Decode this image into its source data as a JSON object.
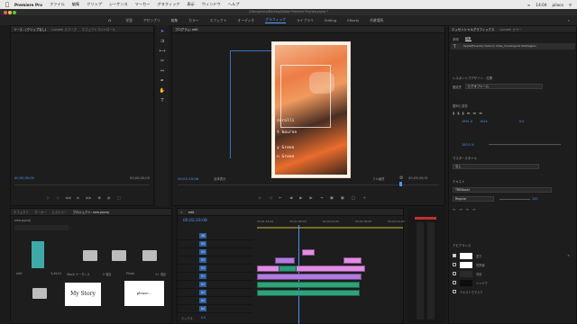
{
  "menubar": {
    "app": "Premiere Pro",
    "items": [
      "ファイル",
      "編集",
      "クリップ",
      "シーケンス",
      "マーカー",
      "グラフィック",
      "表示",
      "ウィンドウ",
      "ヘルプ"
    ],
    "time": "14:04",
    "user": "pilaco"
  },
  "titlebar": {
    "path": "/Users/pilaco/Desktop/Adobe Premiere Pro/new.prproj *"
  },
  "workspaces": {
    "items": [
      "学習",
      "アセンブリ",
      "編集",
      "カラー",
      "エフェクト",
      "オーディオ",
      "グラフィック",
      "ライブラリ",
      "Editing",
      "Effects",
      "作業場所"
    ],
    "active_index": 6
  },
  "source": {
    "tabs": [
      "ソース : (クリップなし)",
      "Lumetri スコープ",
      "エフェクトコントロール"
    ],
    "active_tab": 0,
    "timecode_left": "00;00;00;00",
    "timecode_right": "00;00;00;00"
  },
  "program": {
    "tab": "プログラム: edit",
    "timecode": "00;02;19;08",
    "fit": "全体表示",
    "quality": "フル画質",
    "duration": "00;03;45;01",
    "overlay_lines": [
      "scrolli",
      "t bourne",
      "y Green",
      "n Green"
    ]
  },
  "essential": {
    "tabs": [
      "エッセンシャルグラフィックス",
      "Lumetri カラー"
    ],
    "subtabs": [
      "参照",
      "編集"
    ],
    "active_subtab": 1,
    "layer": "Sp[lat]Fluente] Verbum Vitae_Vocalkaynet Methaglian",
    "responsive_label": "レスポンシブデザイン - 位置",
    "pin_label": "固定先",
    "pin_value": "ビデオフレーム",
    "align_label": "整列と変形",
    "position_x": "1091.0",
    "position_y": "1024",
    "rotation": "0.0",
    "scale": "100.0 %",
    "master_style_label": "マスタースタイル",
    "master_style_value": "なし",
    "text_label": "テキスト",
    "font": "TRBBoost",
    "font_style": "Regular",
    "font_size": "120",
    "appearance_label": "アピアランス",
    "appearance_items": [
      "塗り",
      "境界線",
      "背景",
      "シャドウ",
      "テキストでマスク"
    ]
  },
  "project": {
    "tabs": [
      "エフェクト",
      "マーカー",
      "ヒストリー",
      "プロジェクト: new.prproj"
    ],
    "active_tab": 3,
    "file": "new.prproj",
    "items": [
      {
        "name": "edit",
        "duration": "3;45;01",
        "kind": "sequence"
      },
      {
        "name": "Stock ナーダンス",
        "duration": "",
        "kind": "folder"
      },
      {
        "name": "2 項目",
        "duration": "",
        "kind": "folder"
      },
      {
        "name": "Photo",
        "duration": "",
        "kind": "folder"
      },
      {
        "name": "1+ 項目",
        "duration": "",
        "kind": "folder"
      },
      {
        "name": "",
        "duration": "",
        "kind": "folder"
      },
      {
        "name": "",
        "duration": "",
        "kind": "handwritten",
        "text": "My Story"
      },
      {
        "name": "",
        "duration": "",
        "kind": "handwritten",
        "text": "please..."
      }
    ]
  },
  "timeline": {
    "tab": "edit",
    "timecode": "00;02;19;08",
    "ruler": [
      "00;01;54;00",
      "00;01;58;00",
      "00;02;02;00",
      "00;02;06;00",
      "00;02;10;00",
      "00;02;14;00"
    ],
    "video_tracks": [
      "V6",
      "V5",
      "V4",
      "V3",
      "V2",
      "V1"
    ],
    "audio_tracks": [
      "A1",
      "A2",
      "A3",
      "A4"
    ],
    "mix_label": "ミックス",
    "mix_value": "0.0"
  },
  "colors": {
    "accent": "#4f93ff",
    "clip_pink": "#e28ce6",
    "clip_purple": "#b27be0",
    "clip_teal": "#2f9a7a",
    "clip_audio": "#30a27a"
  }
}
